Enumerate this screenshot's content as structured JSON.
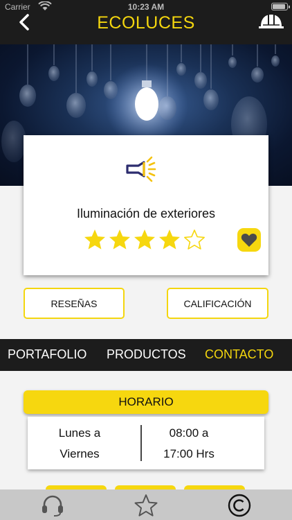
{
  "status": {
    "carrier": "Carrier",
    "time": "10:23 AM"
  },
  "header": {
    "title": "ECOLUCES",
    "back_icon": "chevron-left-icon",
    "profile_icon": "hard-hat-icon"
  },
  "hero": {
    "image": "hanging-light-bulbs-photo"
  },
  "service": {
    "icon": "flashlight-icon",
    "name": "Iluminación de exteriores",
    "rating": 4,
    "rating_max": 5,
    "favorite_icon": "heart-icon"
  },
  "actions": {
    "reviews_label": "RESEÑAS",
    "rate_label": "CALIFICACIÓN"
  },
  "tabs": [
    {
      "label": "PORTAFOLIO",
      "active": false
    },
    {
      "label": "PRODUCTOS",
      "active": false
    },
    {
      "label": "CONTACTO",
      "active": true
    }
  ],
  "schedule": {
    "heading": "HORARIO",
    "days_line1": "Lunes a",
    "days_line2": "Viernes",
    "open": "08:00 a",
    "close": "17:00 Hrs"
  },
  "bottom_nav": [
    {
      "icon": "headset-icon"
    },
    {
      "icon": "star-outline-icon"
    },
    {
      "icon": "copyright-icon"
    }
  ],
  "colors": {
    "accent": "#f4d60e",
    "dark": "#1c1c1c",
    "icon_blue": "#2c2c6e"
  }
}
